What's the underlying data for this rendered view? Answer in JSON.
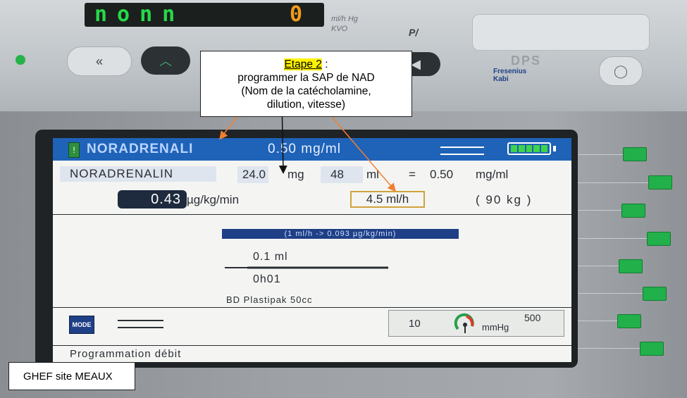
{
  "device": {
    "led_display": "nonn",
    "led_digit": "0",
    "unit_labels": [
      "ml/h",
      "KVO"
    ],
    "unit_labels_right": "Hg",
    "pa_label": "P/",
    "dps_label": "DPS",
    "brand": [
      "Fresenius",
      "Kabi"
    ]
  },
  "screen": {
    "title_bar": {
      "drug_name": "NORADRENALI",
      "concentration": "0.50 mg/ml"
    },
    "dilution": {
      "drug_name": "NORADRENALIN",
      "amount": "24.0",
      "amount_unit": "mg",
      "volume": "48",
      "volume_unit": "ml",
      "equals": "=",
      "result": "0.50",
      "result_unit": "mg/ml"
    },
    "rate": {
      "dose": "0.43",
      "dose_unit": "µg/kg/min",
      "flow": "4.5 ml/h",
      "weight": "( 90 kg )"
    },
    "equivalence": "(1 ml/h -> 0.093 µg/kg/min)",
    "syringe": {
      "volume": "0.1 ml",
      "time": "0h01",
      "name": "BD Plastipak 50cc"
    },
    "mode_button": "MODE",
    "pressure": {
      "low": "10",
      "high": "500",
      "unit": "mmHg"
    },
    "status": "Programmation débit"
  },
  "annotation": {
    "title": "Etape 2",
    "title_suffix": " :",
    "lines": [
      "programmer la SAP de NAD",
      "(Nom de la catécholamine,",
      "dilution, vitesse)"
    ]
  },
  "site_label": "GHEF site  MEAUX",
  "colors": {
    "title_bar": "#1f63b8",
    "side_buttons": "#21b04a",
    "rate_highlight": "#d0a23c",
    "annotation_highlight": "#fff200",
    "arrow": "#f08030"
  }
}
